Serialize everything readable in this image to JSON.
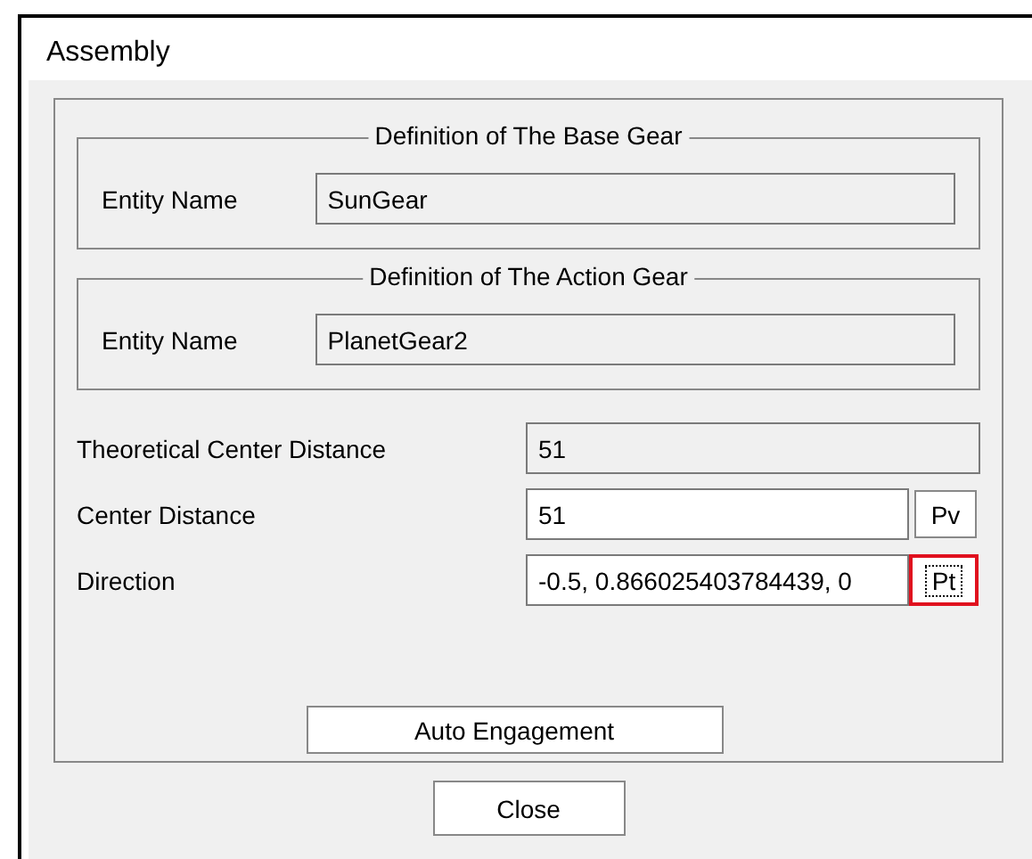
{
  "window": {
    "title": "Assembly"
  },
  "groups": [
    {
      "title": "Definition of The Base Gear",
      "label": "Entity Name",
      "value": "SunGear",
      "readonly": true
    },
    {
      "title": "Definition of The Action Gear",
      "label": "Entity Name",
      "value": "PlanetGear2",
      "readonly": true
    }
  ],
  "rows": [
    {
      "label": "Theoretical Center Distance",
      "value": "51",
      "readonly": true
    },
    {
      "label": "Center Distance",
      "value": "51",
      "readonly": false,
      "button": {
        "label": "Pv",
        "highlighted": false
      }
    },
    {
      "label": "Direction",
      "value": "-0.5, 0.866025403784439, 0",
      "readonly": false,
      "button": {
        "label": "Pt",
        "highlighted": true
      }
    }
  ],
  "auto_button": "Auto Engagement",
  "close_button": "Close"
}
